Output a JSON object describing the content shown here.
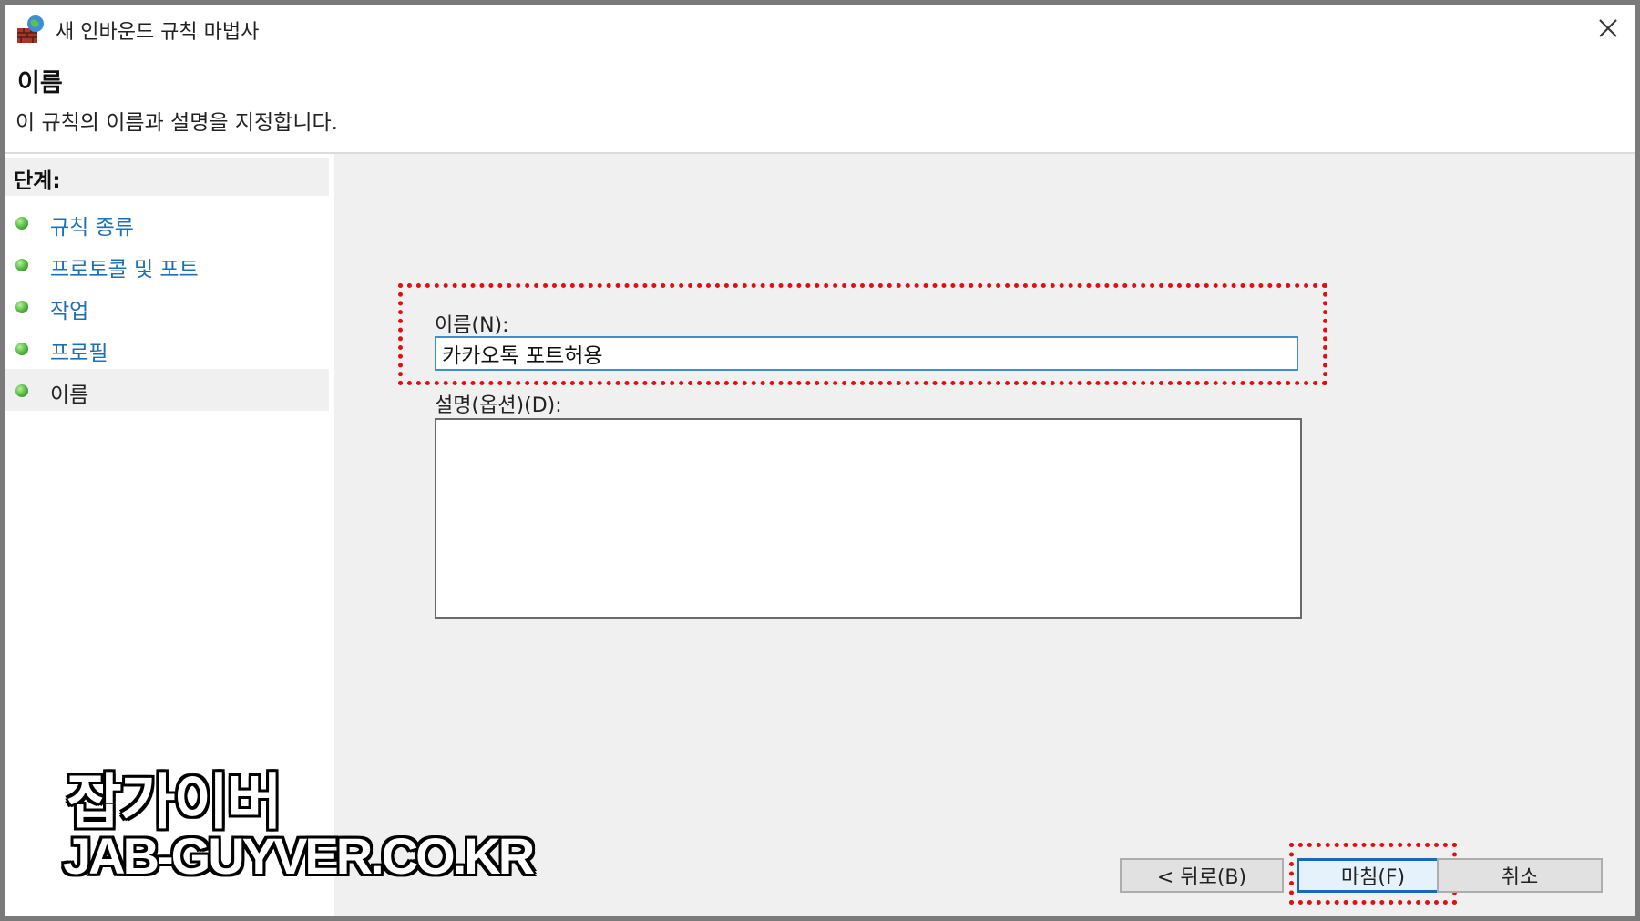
{
  "window": {
    "title": "새 인바운드 규칙 마법사",
    "icon": "firewall-globe-icon"
  },
  "header": {
    "title": "이름",
    "subtitle": "이 규칙의 이름과 설명을 지정합니다."
  },
  "steps": {
    "heading": "단계:",
    "items": [
      {
        "label": "규칙 종류",
        "active": false
      },
      {
        "label": "프로토콜 및 포트",
        "active": false
      },
      {
        "label": "작업",
        "active": false
      },
      {
        "label": "프로필",
        "active": false
      },
      {
        "label": "이름",
        "active": true
      }
    ]
  },
  "form": {
    "name_label": "이름(N):",
    "name_value": "카카오톡 포트허용",
    "desc_label": "설명(옵션)(D):",
    "desc_value": ""
  },
  "buttons": {
    "back": "< 뒤로(B)",
    "finish": "마침(F)",
    "cancel": "취소"
  },
  "watermark": {
    "title": "잡가이버",
    "url": "JAB-GUYVER.CO.KR"
  },
  "colors": {
    "link": "#1f6fb3",
    "highlight": "#e01010",
    "focus_border": "#3d8fd1"
  }
}
